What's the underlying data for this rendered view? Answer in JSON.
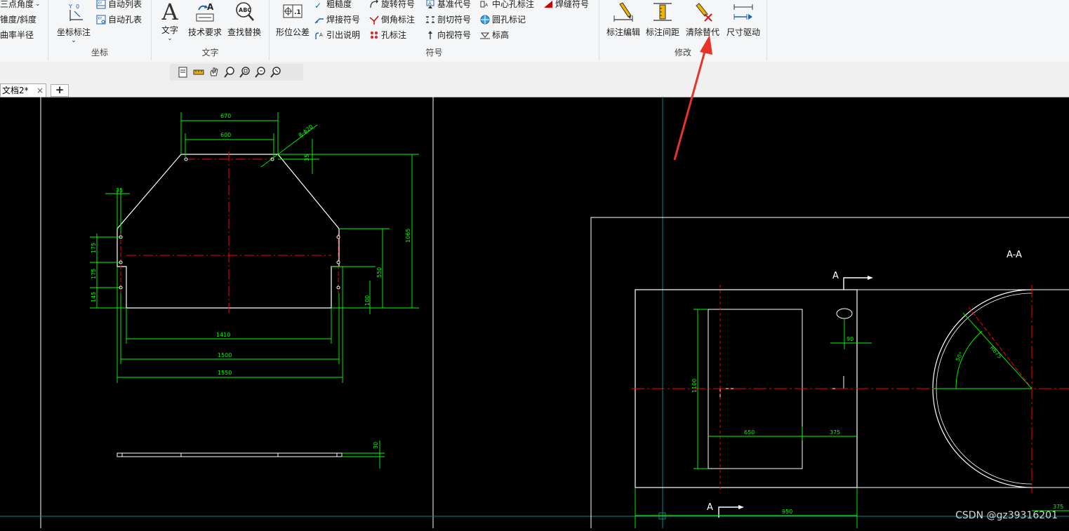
{
  "ribbon": {
    "groups": {
      "angle": {
        "items": [
          "三点角度",
          "锥度/斜度",
          "曲率半径"
        ]
      },
      "coord": {
        "label": "坐标",
        "big_button": "坐标标注",
        "items": [
          "自动列表",
          "自动孔表"
        ]
      },
      "text": {
        "label": "文字",
        "buttons": [
          "文字",
          "技术要求",
          "查找替换"
        ]
      },
      "symbol": {
        "label": "符号",
        "big_button": "形位公差",
        "col1": [
          "粗糙度",
          "焊接符号",
          "引出说明"
        ],
        "col2": [
          "旋转符号",
          "倒角标注",
          "孔标注"
        ],
        "col3": [
          "基准代号",
          "剖切符号",
          "向视符号"
        ],
        "col4": [
          "中心孔标注",
          "圆孔标记",
          "标高"
        ],
        "col5": [
          "焊缝符号"
        ]
      },
      "modify": {
        "label": "修改",
        "buttons": [
          "标注编辑",
          "标注间距",
          "清除替代",
          "尺寸驱动"
        ]
      }
    }
  },
  "document_tab": {
    "title": "文档2*",
    "close": "×",
    "add": "+"
  },
  "drawing": {
    "view1": {
      "dims_top": [
        "670",
        "600"
      ],
      "hole_callout": "8-ϕ20",
      "dims_left": [
        "35",
        "175",
        "175",
        "145"
      ],
      "dims_right": [
        "35",
        "1065",
        "550",
        "100"
      ],
      "dims_bottom": [
        "1410",
        "1500",
        "1550"
      ]
    },
    "view2": {
      "thickness": "30"
    },
    "view3": {
      "section_label": "A-A",
      "arrow_labels": [
        "A",
        "A"
      ],
      "dims": [
        "1100",
        "650",
        "375",
        "950",
        "90",
        "50°",
        "R675",
        "375"
      ]
    }
  },
  "colors": {
    "outline": "#ffffff",
    "dimension": "#00ff00",
    "centerline": "#ff0000",
    "frame_line": "#00aaaa",
    "annotation_arrow": "#e8332a"
  },
  "watermark": "CSDN @gz39316201"
}
